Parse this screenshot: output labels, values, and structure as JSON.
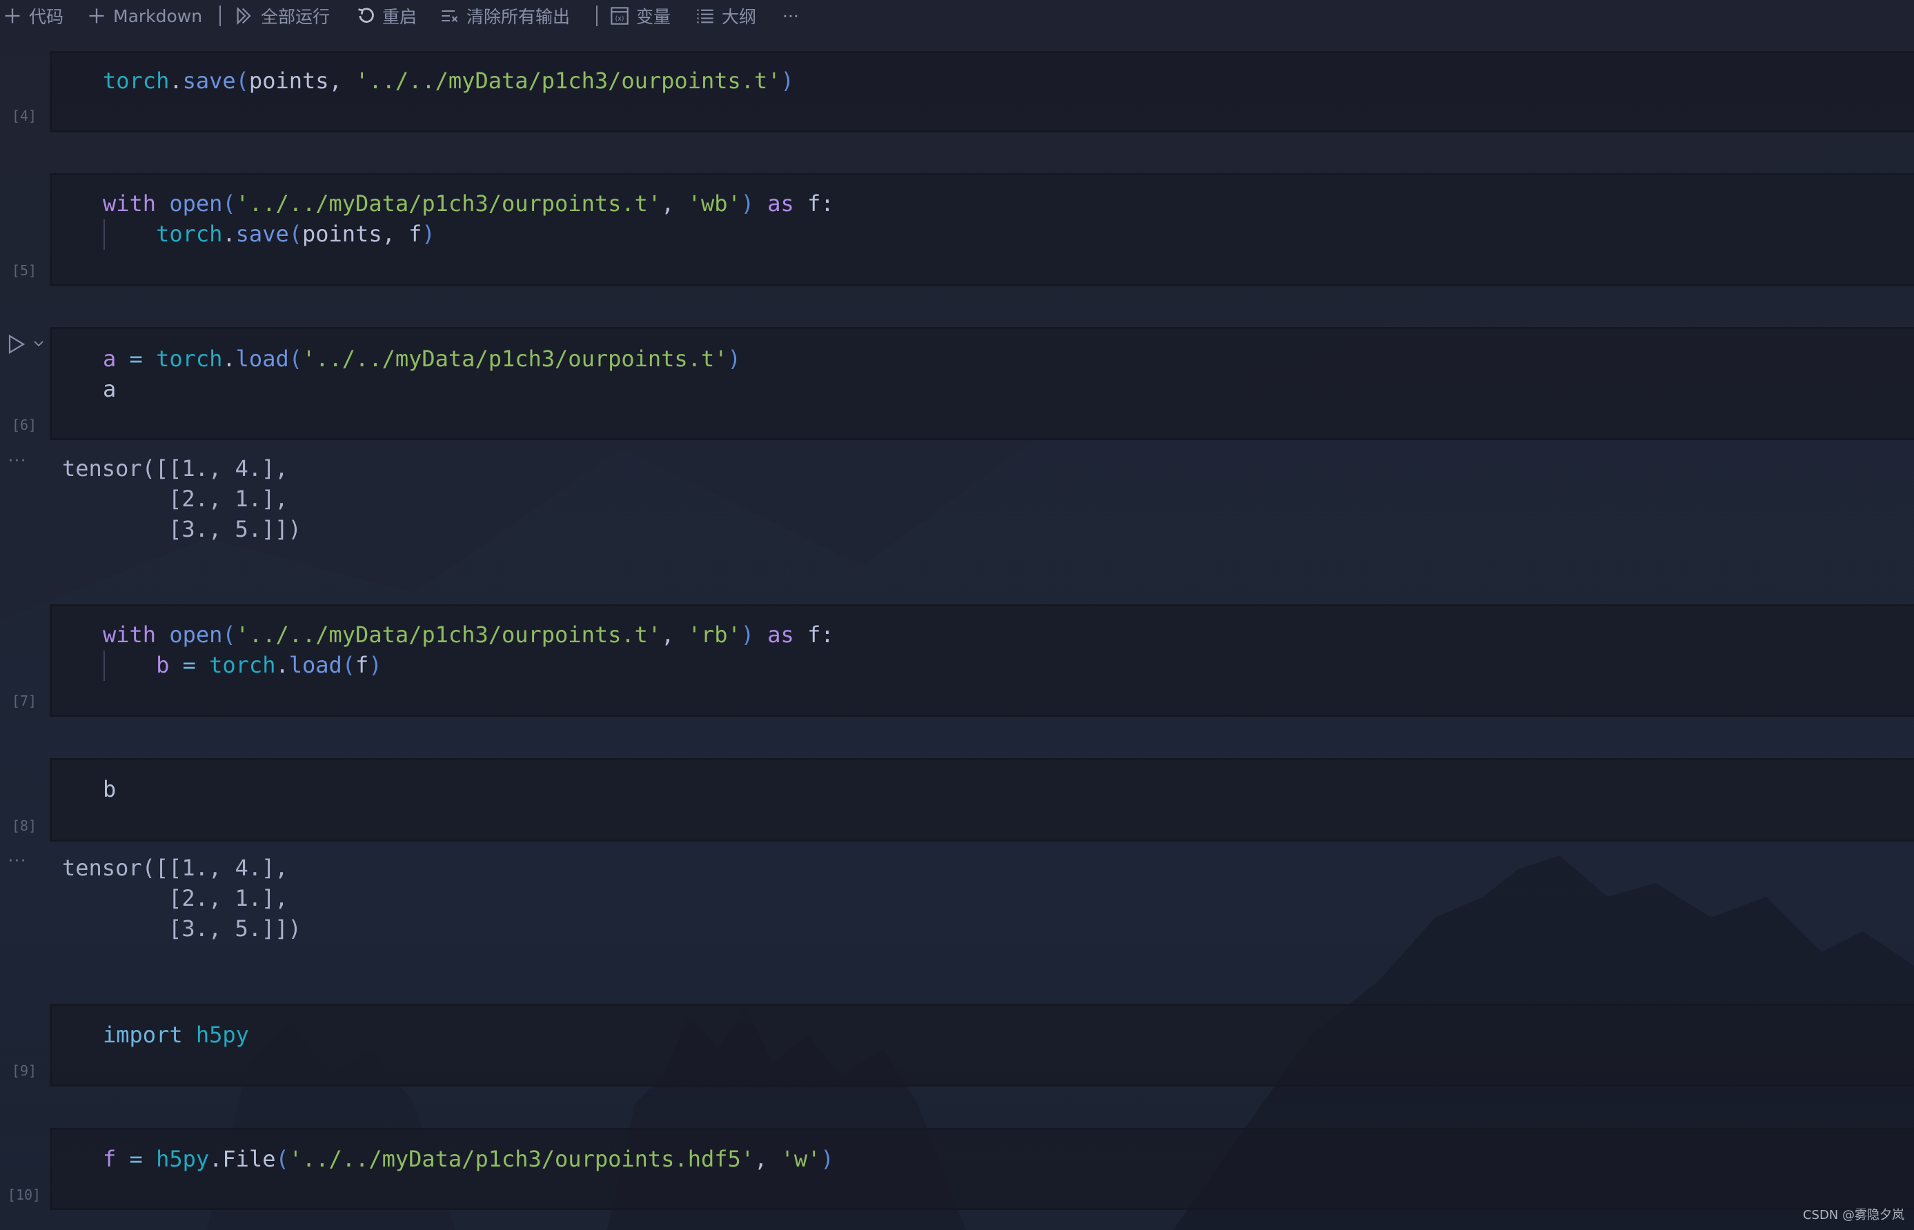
{
  "toolbar": {
    "add_code": "代码",
    "add_markdown": "Markdown",
    "run_all": "全部运行",
    "restart": "重启",
    "clear_outputs": "清除所有输出",
    "variables": "变量",
    "outline": "大纲",
    "more": "···"
  },
  "cells": [
    {
      "exec_count": "[4]",
      "lines": [
        [
          [
            "torch",
            "mod"
          ],
          [
            ".",
            "id"
          ],
          [
            "save",
            "fn"
          ],
          [
            "(",
            "pn"
          ],
          [
            "points, ",
            "id"
          ],
          [
            "'../../myData/p1ch3/ourpoints.t'",
            "str"
          ],
          [
            ")",
            "pn"
          ]
        ]
      ]
    },
    {
      "exec_count": "[5]",
      "lines": [
        [
          [
            "with ",
            "kw"
          ],
          [
            "open",
            "fn"
          ],
          [
            "(",
            "pn"
          ],
          [
            "'../../myData/p1ch3/ourpoints.t'",
            "str"
          ],
          [
            ", ",
            "id"
          ],
          [
            "'wb'",
            "str"
          ],
          [
            ")",
            "pn"
          ],
          [
            " as ",
            "kw"
          ],
          [
            "f",
            "id"
          ],
          [
            ":",
            "id"
          ]
        ],
        [
          [
            "    ",
            "id"
          ],
          [
            "torch",
            "mod"
          ],
          [
            ".",
            "id"
          ],
          [
            "save",
            "fn"
          ],
          [
            "(",
            "pn"
          ],
          [
            "points, f",
            "id"
          ],
          [
            ")",
            "pn"
          ]
        ]
      ]
    },
    {
      "exec_count": "[6]",
      "lines": [
        [
          [
            "a",
            "kw"
          ],
          [
            " = ",
            "op"
          ],
          [
            "torch",
            "mod"
          ],
          [
            ".",
            "id"
          ],
          [
            "load",
            "fn"
          ],
          [
            "(",
            "pn"
          ],
          [
            "'../../myData/p1ch3/ourpoints.t'",
            "str"
          ],
          [
            ")",
            "pn"
          ]
        ],
        [
          [
            "a",
            "id"
          ]
        ]
      ],
      "output": [
        "tensor([[1., 4.],",
        "        [2., 1.],",
        "        [3., 5.]])"
      ]
    },
    {
      "exec_count": "[7]",
      "lines": [
        [
          [
            "with ",
            "kw"
          ],
          [
            "open",
            "fn"
          ],
          [
            "(",
            "pn"
          ],
          [
            "'../../myData/p1ch3/ourpoints.t'",
            "str"
          ],
          [
            ", ",
            "id"
          ],
          [
            "'rb'",
            "str"
          ],
          [
            ")",
            "pn"
          ],
          [
            " as ",
            "kw"
          ],
          [
            "f",
            "id"
          ],
          [
            ":",
            "id"
          ]
        ],
        [
          [
            "    ",
            "id"
          ],
          [
            "b",
            "kw"
          ],
          [
            " = ",
            "op"
          ],
          [
            "torch",
            "mod"
          ],
          [
            ".",
            "id"
          ],
          [
            "load",
            "fn"
          ],
          [
            "(",
            "pn"
          ],
          [
            "f",
            "id"
          ],
          [
            ")",
            "pn"
          ]
        ]
      ]
    },
    {
      "exec_count": "[8]",
      "lines": [
        [
          [
            "b",
            "id"
          ]
        ]
      ],
      "output": [
        "tensor([[1., 4.],",
        "        [2., 1.],",
        "        [3., 5.]])"
      ]
    },
    {
      "exec_count": "[9]",
      "lines": [
        [
          [
            "import ",
            "imp"
          ],
          [
            "h5py",
            "mod"
          ]
        ]
      ]
    },
    {
      "exec_count": "[10]",
      "lines": [
        [
          [
            "f",
            "kw"
          ],
          [
            " = ",
            "op"
          ],
          [
            "h5py",
            "mod"
          ],
          [
            ".",
            "id"
          ],
          [
            "File",
            "id"
          ],
          [
            "(",
            "pn"
          ],
          [
            "'../../myData/p1ch3/ourpoints.hdf5'",
            "str"
          ],
          [
            ", ",
            "id"
          ],
          [
            "'w'",
            "str"
          ],
          [
            ")",
            "pn"
          ]
        ]
      ]
    }
  ],
  "output_more_label": "···",
  "watermark": "CSDN @雾隐夕岚"
}
